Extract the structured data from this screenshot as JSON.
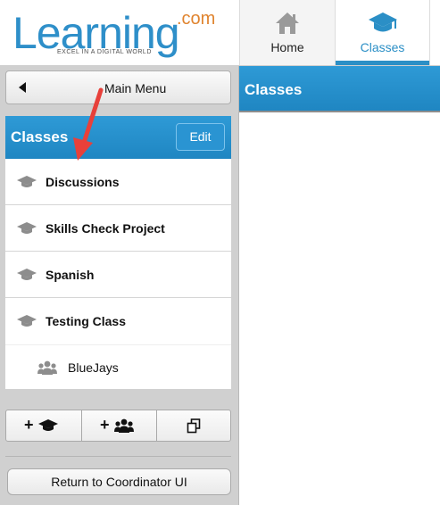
{
  "logo": {
    "word": "Learning",
    "suffix": ".com",
    "tagline": "EXCEL IN A DIGITAL WORLD"
  },
  "nav": {
    "home_label": "Home",
    "classes_label": "Classes",
    "active": "Classes"
  },
  "sidebar": {
    "main_menu_label": "Main Menu",
    "classes_title": "Classes",
    "edit_label": "Edit",
    "classes": [
      {
        "label": "Discussions",
        "icon": "graduation-cap-icon"
      },
      {
        "label": "Skills Check Project",
        "icon": "graduation-cap-icon"
      },
      {
        "label": "Spanish",
        "icon": "graduation-cap-icon"
      },
      {
        "label": "Testing Class",
        "icon": "graduation-cap-icon"
      }
    ],
    "groups": [
      {
        "label": "BlueJays",
        "icon": "group-icon"
      }
    ],
    "toolbar": {
      "add_class_icon": "add-class-icon",
      "add_group_icon": "add-group-icon",
      "copy_icon": "copy-icon"
    },
    "return_label": "Return to Coordinator UI"
  },
  "main": {
    "title": "Classes"
  },
  "colors": {
    "brand_blue": "#2b8fc6",
    "brand_orange": "#e0842f",
    "annotation_red": "#e8403a"
  }
}
